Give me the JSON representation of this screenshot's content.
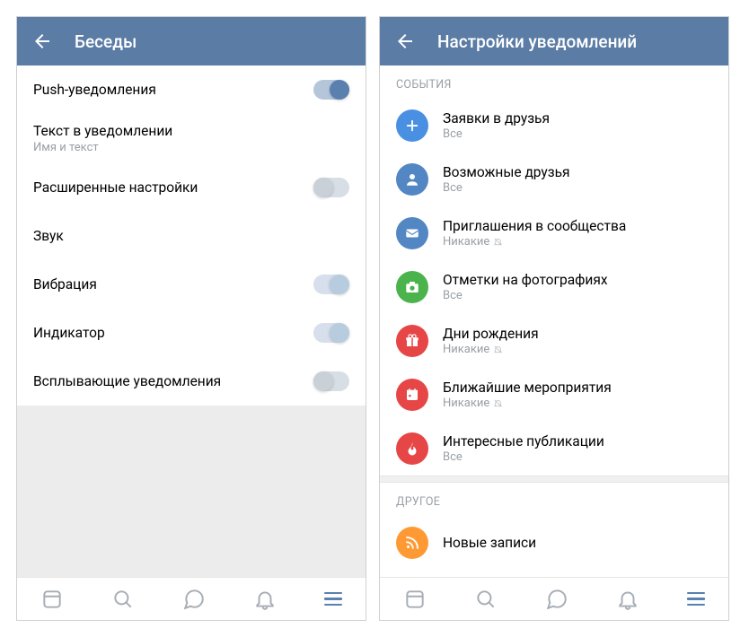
{
  "left": {
    "title": "Беседы",
    "rows": [
      {
        "title": "Push-уведомления",
        "toggle": "on"
      },
      {
        "title": "Текст в уведомлении",
        "sub": "Имя и текст"
      },
      {
        "title": "Расширенные настройки",
        "toggle": "off"
      },
      {
        "title": "Звук"
      },
      {
        "title": "Вибрация",
        "toggle": "faint-on"
      },
      {
        "title": "Индикатор",
        "toggle": "faint-on"
      },
      {
        "title": "Всплывающие уведомления",
        "toggle": "off"
      }
    ]
  },
  "right": {
    "title": "Настройки уведомлений",
    "section1": "События",
    "section2": "Другое",
    "items": [
      {
        "title": "Заявки в друзья",
        "sub": "Все",
        "icon": "plus",
        "color": "blue",
        "muted": false
      },
      {
        "title": "Возможные друзья",
        "sub": "Все",
        "icon": "user",
        "color": "blue2",
        "muted": false
      },
      {
        "title": "Приглашения в сообщества",
        "sub": "Никакие",
        "icon": "mail",
        "color": "blue2",
        "muted": true
      },
      {
        "title": "Отметки на фотографиях",
        "sub": "Все",
        "icon": "camera",
        "color": "green",
        "muted": false
      },
      {
        "title": "Дни рождения",
        "sub": "Никакие",
        "icon": "gift",
        "color": "red",
        "muted": true
      },
      {
        "title": "Ближайшие мероприятия",
        "sub": "Никакие",
        "icon": "calendar",
        "color": "red2",
        "muted": true
      },
      {
        "title": "Интересные публикации",
        "sub": "Все",
        "icon": "fire",
        "color": "red3",
        "muted": false
      }
    ],
    "other_item": {
      "title": "Новые записи",
      "icon": "rss",
      "color": "orange"
    }
  }
}
